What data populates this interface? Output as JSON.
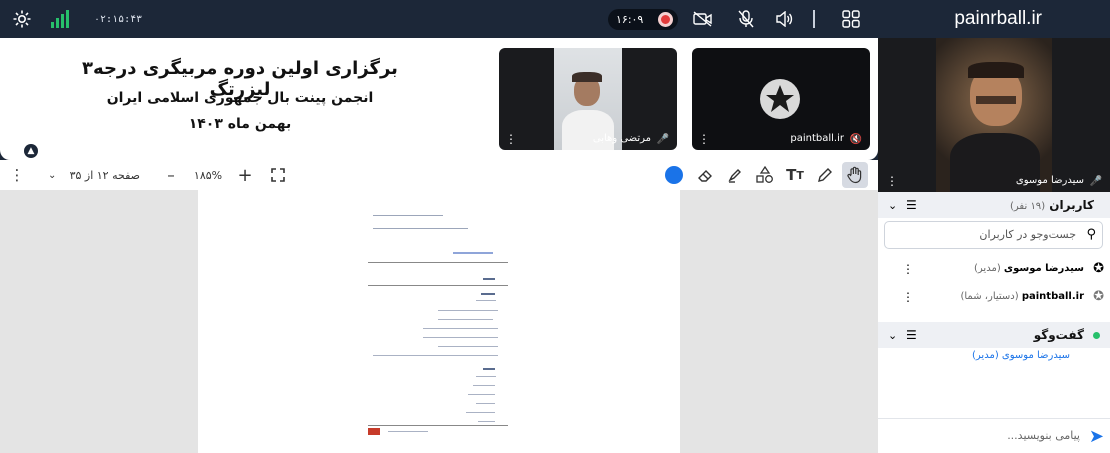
{
  "topbar": {
    "brand": "painrball.ir",
    "recording_time": "۱۶:۰۹",
    "session_clock": "۰۲:۱۵:۴۳",
    "icons": [
      "grid-icon",
      "speaker-icon",
      "mic-off-icon",
      "camera-off-icon",
      "record-icon",
      "signal-icon",
      "gear-icon"
    ]
  },
  "stage": {
    "title_line1": "برگزاری اولین دوره مربیگری درجه۳ لیزرتگ",
    "title_line2": "انجمن پینت بال جمهوری اسلامی ایران",
    "title_line3": "بهمن ماه  ۱۴۰۳"
  },
  "tiles": [
    {
      "name": "paintball.ir",
      "mic": "mic-off"
    },
    {
      "name": "مرتضی وهابی",
      "mic": "mic"
    }
  ],
  "toolbar": {
    "zoom": "۱۸۵%",
    "page_info": "صفحه ۱۲ از ۳۵",
    "accent": "#1a73e8"
  },
  "sidebar": {
    "main_speaker": "سیدرضا موسوی",
    "users_title": "کاربران",
    "users_count": "(۱۹ نفر)",
    "search_placeholder": "جست‌وجو در کاربران",
    "users": [
      {
        "name": "سیدرضا موسوی",
        "role": "(مدیر)"
      },
      {
        "name": "paintball.ir",
        "role": "(دستیار، شما)"
      }
    ],
    "chat_title": "گفت‌وگو",
    "chat_message_author": "سیدرضا موسوی (مدیر)",
    "chat_placeholder": "پیامی بنویسید..."
  }
}
